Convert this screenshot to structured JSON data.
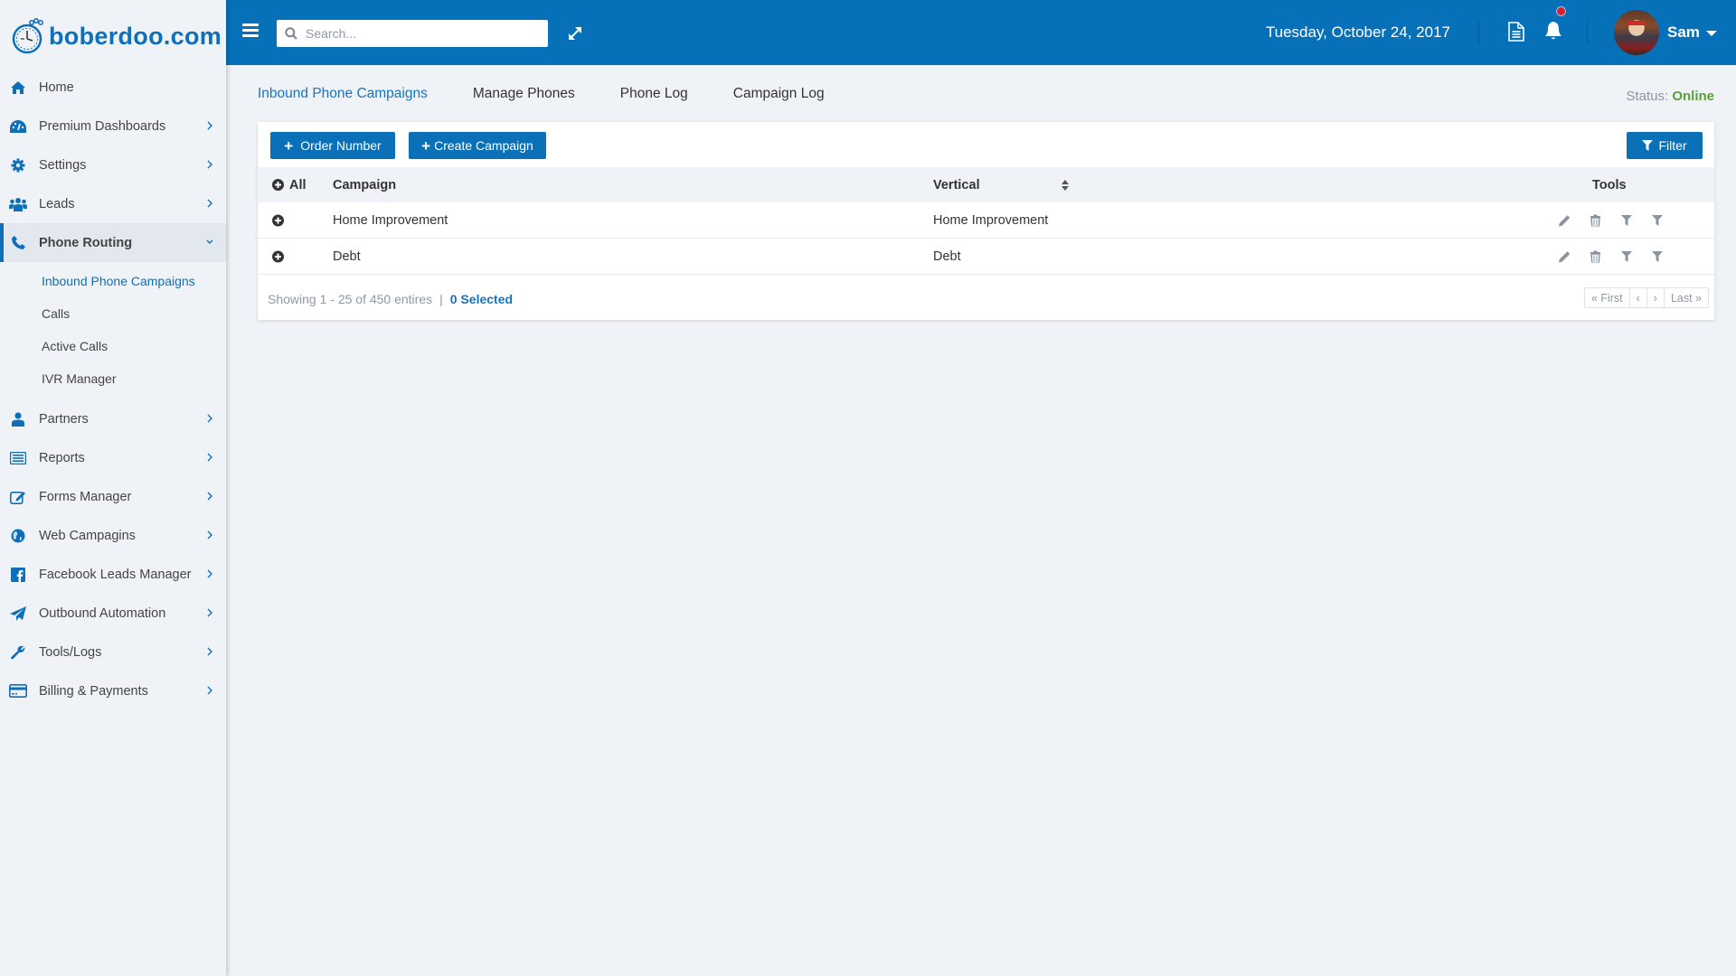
{
  "brand": {
    "name": "boberdoo.com",
    "color": "#0f6fb8"
  },
  "header": {
    "search_placeholder": "Search...",
    "date": "Tuesday, October 24, 2017",
    "user_name": "Sam",
    "icons": [
      "menu-icon",
      "search-icon",
      "expand-icon",
      "document-icon",
      "bell-icon",
      "avatar",
      "caret-down-icon"
    ],
    "notification_badge": true
  },
  "sidebar": {
    "items": [
      {
        "label": "Home",
        "icon": "home-icon",
        "has_children": false
      },
      {
        "label": "Premium Dashboards",
        "icon": "dashboard-icon",
        "has_children": true
      },
      {
        "label": "Settings",
        "icon": "gear-icon",
        "has_children": true
      },
      {
        "label": "Leads",
        "icon": "users-icon",
        "has_children": true
      },
      {
        "label": "Phone Routing",
        "icon": "phone-icon",
        "has_children": true,
        "expanded": true,
        "children": [
          {
            "label": "Inbound Phone Campaigns",
            "current": true
          },
          {
            "label": "Calls"
          },
          {
            "label": "Active Calls"
          },
          {
            "label": "IVR Manager"
          }
        ]
      },
      {
        "label": "Partners",
        "icon": "user-icon",
        "has_children": true
      },
      {
        "label": "Reports",
        "icon": "list-icon",
        "has_children": true
      },
      {
        "label": "Forms Manager",
        "icon": "edit-icon",
        "has_children": true
      },
      {
        "label": "Web Campagins",
        "icon": "globe-icon",
        "has_children": true
      },
      {
        "label": "Facebook Leads Manager",
        "icon": "facebook-icon",
        "has_children": true
      },
      {
        "label": "Outbound Automation",
        "icon": "paper-plane-icon",
        "has_children": true
      },
      {
        "label": "Tools/Logs",
        "icon": "wrench-icon",
        "has_children": true
      },
      {
        "label": "Billing & Payments",
        "icon": "credit-card-icon",
        "has_children": true
      }
    ]
  },
  "main": {
    "tabs": [
      {
        "label": "Inbound Phone Campaigns",
        "active": true
      },
      {
        "label": "Manage Phones"
      },
      {
        "label": "Phone Log"
      },
      {
        "label": "Campaign Log"
      }
    ],
    "status": {
      "label": "Status:",
      "value": "Online",
      "color": "#5aa03b"
    },
    "toolbar": {
      "order_number": "Order Number",
      "create_campaign": "Create Campaign",
      "filter": "Filter"
    },
    "table": {
      "columns": {
        "all": "All",
        "campaign": "Campaign",
        "vertical": "Vertical",
        "tools": "Tools"
      },
      "rows": [
        {
          "campaign": "Home Improvement",
          "vertical": "Home Improvement"
        },
        {
          "campaign": "Debt",
          "vertical": "Debt"
        }
      ],
      "row_tools": [
        "edit-icon",
        "delete-icon",
        "filter-icon",
        "filter-icon"
      ]
    },
    "footer": {
      "showing": "Showing 1 - 25 of 450 entires",
      "separator": "|",
      "selected": "0 Selected"
    },
    "pagination": {
      "first": "« First",
      "prev": "‹",
      "next": "›",
      "last": "Last »"
    }
  }
}
